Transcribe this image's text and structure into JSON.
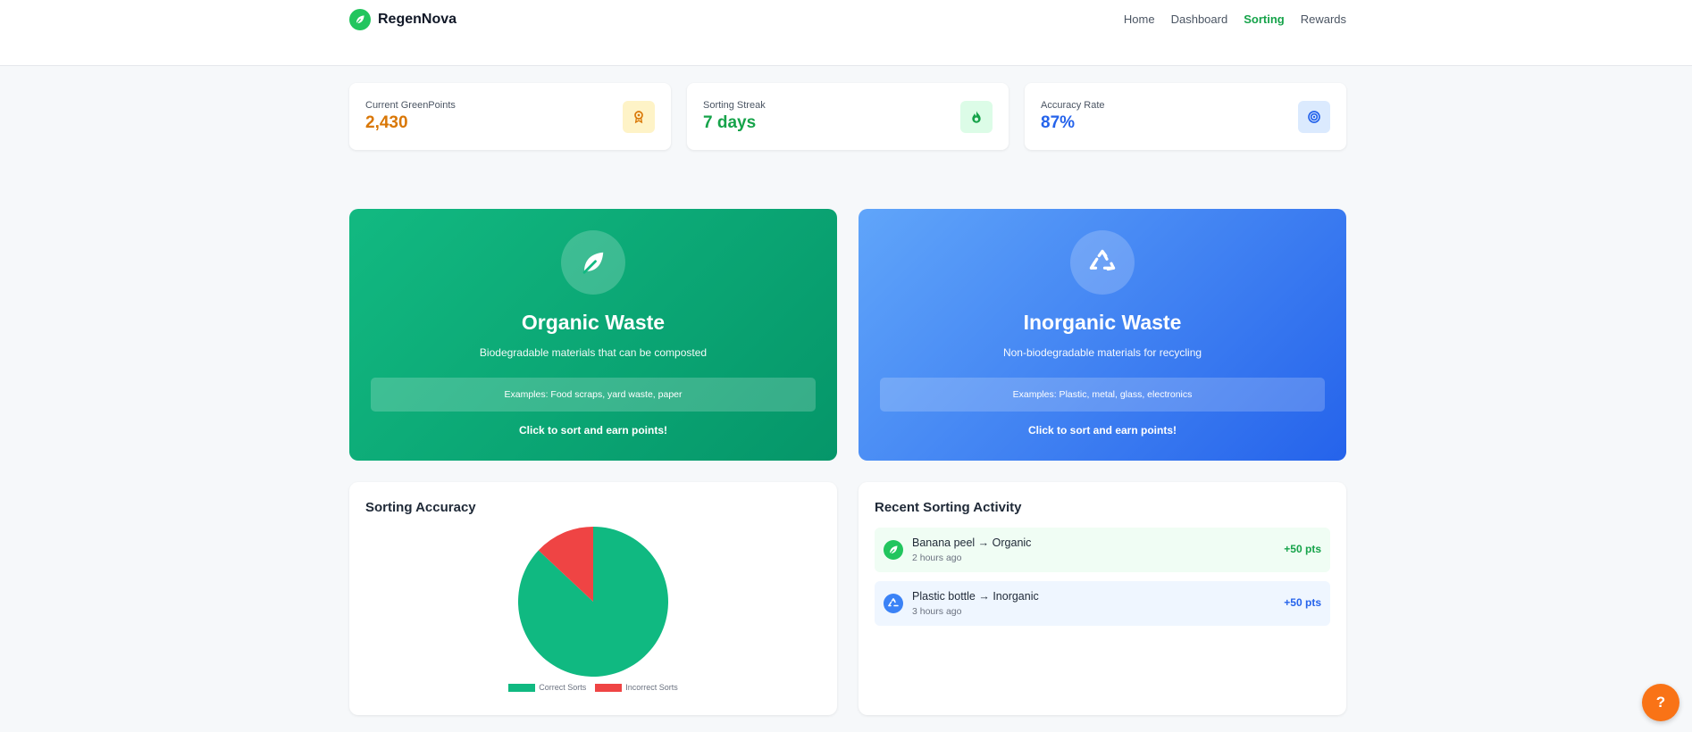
{
  "app": {
    "name": "RegenNova",
    "subtitle_fragment": ""
  },
  "nav": [
    {
      "label": "Home",
      "active": false
    },
    {
      "label": "Dashboard",
      "active": false
    },
    {
      "label": "Sorting",
      "active": true
    },
    {
      "label": "Rewards",
      "active": false
    }
  ],
  "stats": [
    {
      "label": "Current GreenPoints",
      "value": "2,430",
      "color": "#d97706",
      "icon": "award-icon",
      "icon_bg": "#fef3c7"
    },
    {
      "label": "Sorting Streak",
      "value": "7 days",
      "color": "#16a34a",
      "icon": "fire-icon",
      "icon_bg": "#dcfce7"
    },
    {
      "label": "Accuracy Rate",
      "value": "87%",
      "color": "#2563eb",
      "icon": "target-icon",
      "icon_bg": "#dbeafe"
    }
  ],
  "waste_cards": {
    "organic": {
      "title": "Organic Waste",
      "description": "Biodegradable materials that can be composted",
      "examples": "Examples: Food scraps, yard waste, paper",
      "cta": "Click to sort and earn points!"
    },
    "inorganic": {
      "title": "Inorganic Waste",
      "description": "Non-biodegradable materials for recycling",
      "examples": "Examples: Plastic, metal, glass, electronics",
      "cta": "Click to sort and earn points!"
    }
  },
  "accuracy_panel": {
    "title": "Sorting Accuracy"
  },
  "chart_data": {
    "type": "pie",
    "title": "Sorting Accuracy",
    "categories": [
      "Correct Sorts",
      "Incorrect Sorts"
    ],
    "values": [
      87,
      13
    ],
    "colors": [
      "#10b981",
      "#ef4444"
    ],
    "legend": "bottom"
  },
  "activity_panel": {
    "title": "Recent Sorting Activity",
    "items": [
      {
        "name": "Banana peel → Organic",
        "time": "2 hours ago",
        "points": "+50 pts",
        "icon": "leaf-icon"
      },
      {
        "name": "Plastic bottle → Inorganic",
        "time": "3 hours ago",
        "points": "+50 pts",
        "icon": "recycle-icon"
      }
    ]
  },
  "help_button": {
    "label": "?"
  }
}
